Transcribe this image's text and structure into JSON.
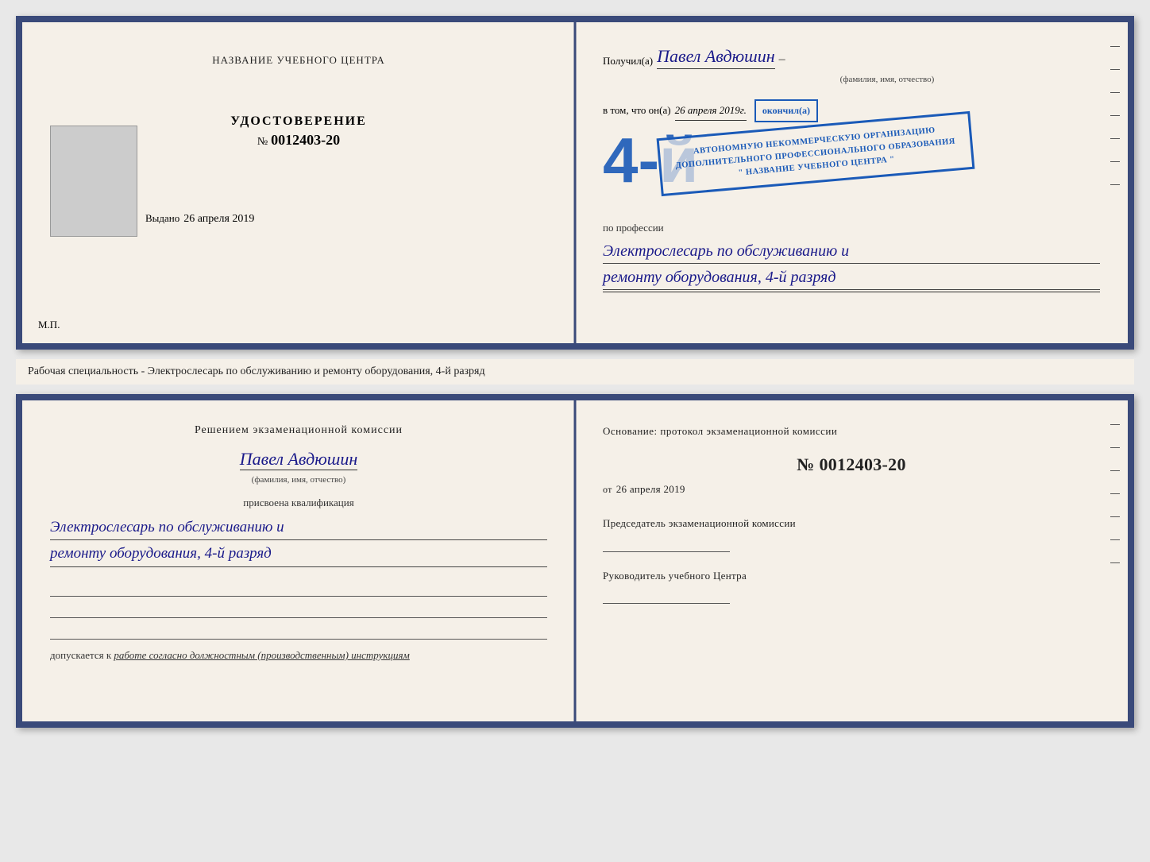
{
  "top_doc": {
    "left": {
      "training_center_label": "НАЗВАНИЕ УЧЕБНОГО ЦЕНТРА",
      "cert_title": "УДОСТОВЕРЕНИЕ",
      "cert_number_prefix": "№",
      "cert_number": "0012403-20",
      "issued_label": "Выдано",
      "issued_date": "26 апреля 2019",
      "mp_label": "М.П."
    },
    "right": {
      "recipient_prefix": "Получил(а)",
      "recipient_name": "Павел Авдюшин",
      "recipient_subtitle": "(фамилия, имя, отчество)",
      "recipient_dash": "–",
      "vtom_label": "в том, что он(а)",
      "vtom_date": "26 апреля 2019г.",
      "okoncil_label": "окончил(а)",
      "grade_number": "4-й",
      "stamp_line1": "АВТОНОМНУЮ НЕКОММЕРЧЕСКУЮ ОРГАНИЗАЦИЮ",
      "stamp_line2": "ДОПОЛНИТЕЛЬНОГО ПРОФЕССИОНАЛЬНОГО ОБРАЗОВАНИЯ",
      "stamp_line3": "\" НАЗВАНИЕ УЧЕБНОГО ЦЕНТРА \"",
      "profession_label": "по профессии",
      "profession_line1": "Электрослесарь по обслуживанию и",
      "profession_line2": "ремонту оборудования, 4-й разряд"
    }
  },
  "middle_text": "Рабочая специальность - Электрослесарь по обслуживанию и ремонту оборудования, 4-й разряд",
  "bottom_doc": {
    "left": {
      "decision_label": "Решением экзаменационной комиссии",
      "person_name": "Павел Авдюшин",
      "person_subtitle": "(фамилия, имя, отчество)",
      "prisvoyena_label": "присвоена квалификация",
      "qual_line1": "Электрослесарь по обслуживанию и",
      "qual_line2": "ремонту оборудования, 4-й разряд",
      "dopuskaetsya_label": "допускается к",
      "dopuskaetsya_value": "работе согласно должностным (производственным) инструкциям"
    },
    "right": {
      "osnov_label": "Основание: протокол экзаменационной комиссии",
      "number_prefix": "№",
      "number_value": "0012403-20",
      "date_prefix": "от",
      "date_value": "26 апреля 2019",
      "chairman_label": "Председатель экзаменационной комиссии",
      "director_label": "Руководитель учебного Центра"
    }
  }
}
